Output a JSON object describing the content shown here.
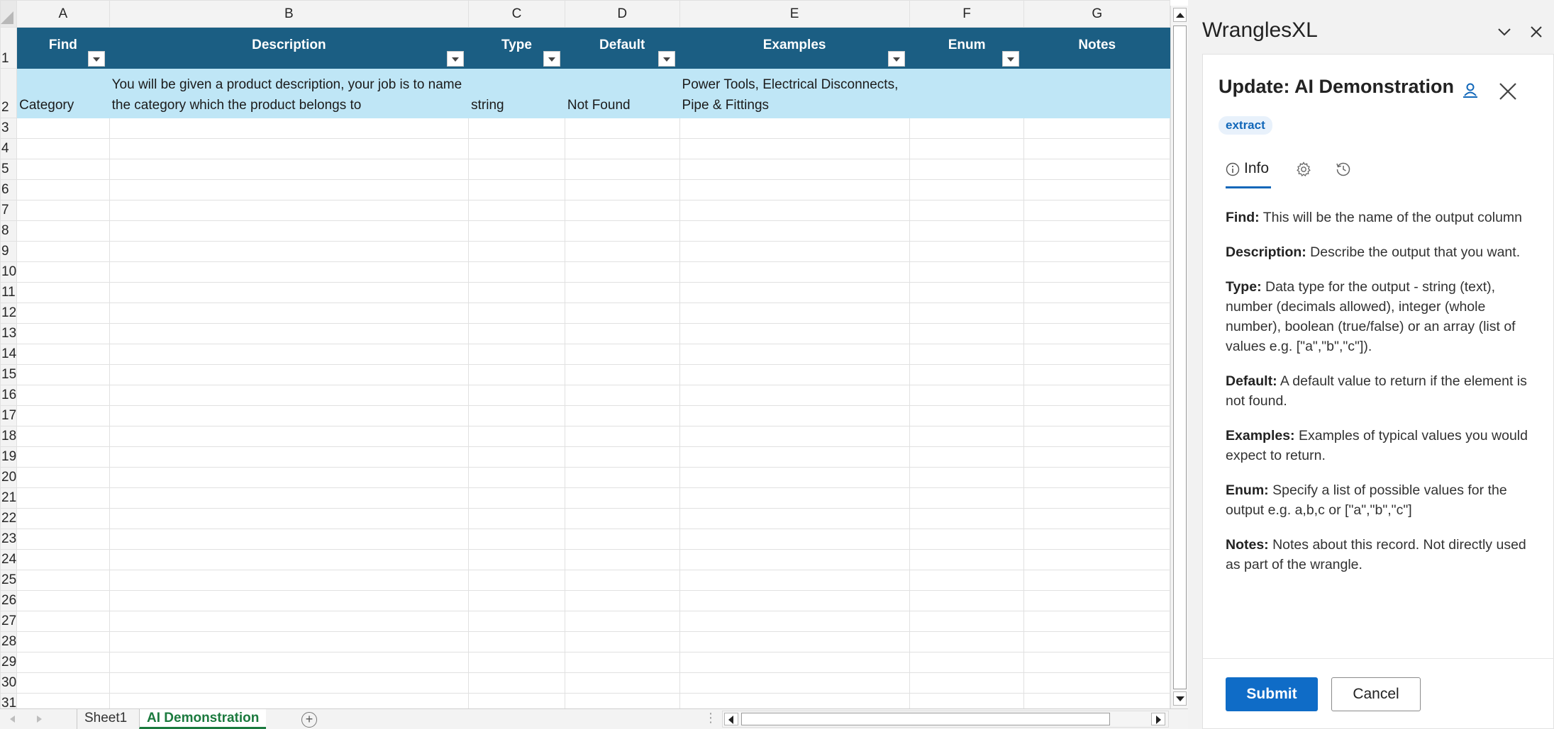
{
  "sheet": {
    "column_letters": [
      "A",
      "B",
      "C",
      "D",
      "E",
      "F",
      "G"
    ],
    "header_row": {
      "row_number": "1",
      "cells": [
        "Find",
        "Description",
        "Type",
        "Default",
        "Examples",
        "Enum",
        "Notes"
      ]
    },
    "data_row": {
      "row_number": "2",
      "cells": [
        "Category",
        "You will be given a product description, your job is to name the category which the product belongs to",
        "string",
        "Not Found",
        "Power Tools, Electrical Disconnects, Pipe & Fittings",
        "",
        ""
      ]
    },
    "empty_row_numbers": [
      "3",
      "4",
      "5",
      "6",
      "7",
      "8",
      "9",
      "10",
      "11",
      "12",
      "13",
      "14",
      "15",
      "16",
      "17",
      "18",
      "19",
      "20",
      "21",
      "22",
      "23",
      "24",
      "25",
      "26",
      "27",
      "28",
      "29",
      "30",
      "31"
    ]
  },
  "tabs_bar": {
    "sheets": [
      "Sheet1",
      "AI Demonstration"
    ],
    "active_sheet": "AI Demonstration",
    "add_symbol": "+"
  },
  "pane": {
    "title": "WranglesXL",
    "card": {
      "title": "Update: AI Demonstration",
      "badge": "extract",
      "tabs": {
        "info_label": "Info"
      },
      "info": [
        {
          "term": "Find:",
          "text": " This will be the name of the output column"
        },
        {
          "term": "Description:",
          "text": " Describe the output that you want."
        },
        {
          "term": "Type:",
          "text": " Data type for the output - string (text), number (decimals allowed), integer (whole number), boolean (true/false) or an array (list of values e.g. [\"a\",\"b\",\"c\"])."
        },
        {
          "term": "Default:",
          "text": " A default value to return if the element is not found."
        },
        {
          "term": "Examples:",
          "text": " Examples of typical values you would expect to return."
        },
        {
          "term": "Enum:",
          "text": " Specify a list of possible values for the output e.g. a,b,c or [\"a\",\"b\",\"c\"]"
        },
        {
          "term": "Notes:",
          "text": " Notes about this record. Not directly used as part of the wrangle."
        }
      ],
      "submit_label": "Submit",
      "cancel_label": "Cancel"
    }
  },
  "colors": {
    "header_fill": "#1b5e83",
    "data_row_fill": "#bfe6f6",
    "active_tab": "#1b7a3e",
    "primary_button": "#0f6cc7"
  }
}
